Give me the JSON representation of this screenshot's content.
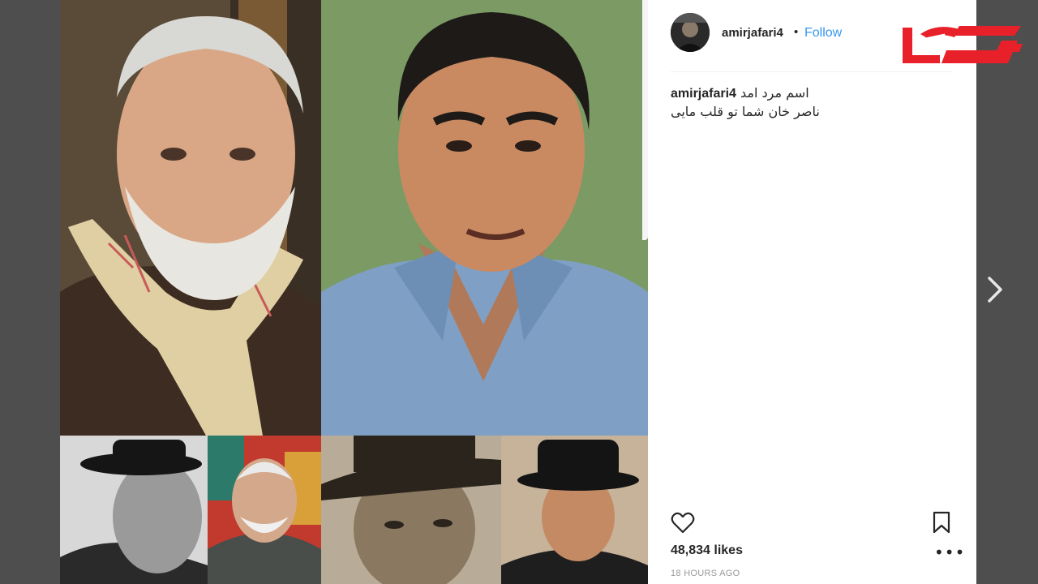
{
  "post": {
    "username": "amirjafari4",
    "separator": "•",
    "follow_label": "Follow",
    "caption_user": "amirjafari4",
    "caption_line1": "اسم مرد امد",
    "caption_line2": "ناصر خان شما تو قلب مایی",
    "likes": "48,834 likes",
    "timestamp": "18 HOURS AGO"
  },
  "icons": {
    "heart": "heart-icon",
    "bookmark": "bookmark-icon",
    "more": "more-options-icon",
    "next": "chevron-right-icon"
  },
  "colors": {
    "follow": "#3897f0",
    "logo_red": "#e8202a",
    "text": "#262626",
    "muted": "#999999"
  }
}
